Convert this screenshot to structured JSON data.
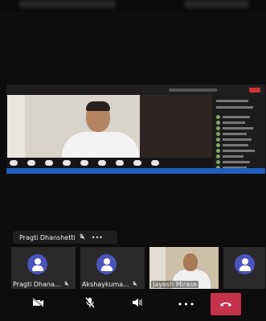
{
  "meeting": {
    "pinned_label": {
      "name": "Pragti Dhanshetti",
      "more": "•••"
    },
    "participants": [
      {
        "name": "Pragti Dhana...",
        "type": "avatar"
      },
      {
        "name": "Akshaykuma...",
        "type": "avatar"
      },
      {
        "name": "Jayesh Mirase",
        "type": "video"
      },
      {
        "name": "",
        "type": "avatar"
      }
    ]
  },
  "controls": {
    "camera_icon": "video-off",
    "mic_icon": "mic-off",
    "speaker_icon": "speaker",
    "more_label": "•••",
    "end_icon": "phone-end"
  },
  "colors": {
    "accent": "#4b53bc",
    "end_call": "#c4314b",
    "background": "#0d0d0d"
  }
}
